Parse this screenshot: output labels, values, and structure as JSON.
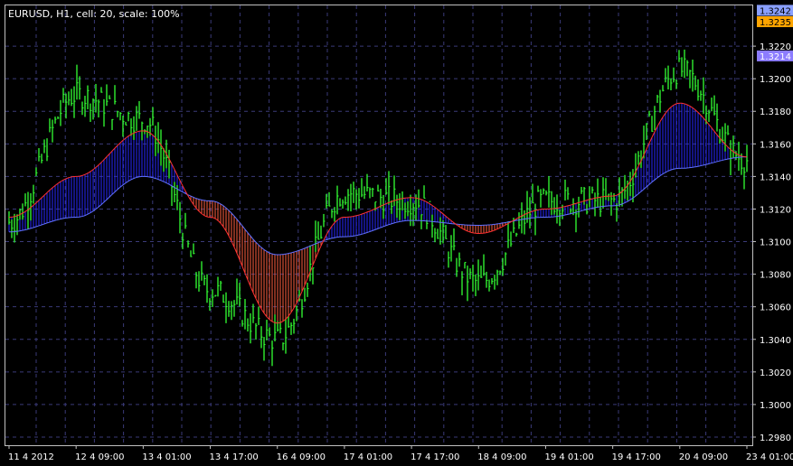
{
  "header": {
    "title": "EURUSD, H1, cell: 20, scale: 100%"
  },
  "price_tags": [
    {
      "label": "1.3242",
      "value": 1.3242,
      "bg": "#8aa0ff",
      "fg": "#000000"
    },
    {
      "label": "1.3235",
      "value": 1.3235,
      "bg": "#ffa500",
      "fg": "#000000"
    },
    {
      "label": "1.3214",
      "value": 1.3214,
      "bg": "#8c7cff",
      "fg": "#ffffff"
    }
  ],
  "colors": {
    "background": "#000000",
    "frame": "#c0c0c0",
    "grid": "#3a3a78",
    "bars": "#33ff33",
    "fast_line": "#ff3030",
    "slow_line": "#6070ff",
    "fill_up": "#2828ff",
    "fill_down": "#ff6040"
  },
  "chart_data": {
    "type": "line",
    "title": "EURUSD, H1, cell: 20, scale: 100%",
    "ylim": [
      1.2975,
      1.3245
    ],
    "grid": true,
    "y_ticks": [
      "1.3220",
      "1.3200",
      "1.3180",
      "1.3160",
      "1.3140",
      "1.3120",
      "1.3100",
      "1.3080",
      "1.3060",
      "1.3040",
      "1.3020",
      "1.3000",
      "1.2980"
    ],
    "x_ticks": [
      "11 4 2012",
      "12 4 09:00",
      "13 4 01:00",
      "13 4 17:00",
      "16 4 09:00",
      "17 4 01:00",
      "17 4 17:00",
      "18 4 09:00",
      "19 4 01:00",
      "19 4 17:00",
      "20 4 09:00",
      "23 4 01:00"
    ],
    "x": [
      "11 4 2012",
      "12 4 09:00",
      "13 4 01:00",
      "13 4 17:00",
      "16 4 09:00",
      "17 4 01:00",
      "17 4 17:00",
      "18 4 09:00",
      "19 4 01:00",
      "19 4 17:00",
      "20 4 09:00",
      "23 4 01:00"
    ],
    "series": [
      {
        "name": "price",
        "values": [
          1.3112,
          1.319,
          1.3175,
          1.307,
          1.304,
          1.313,
          1.3125,
          1.3075,
          1.3125,
          1.3125,
          1.3205,
          1.315
        ]
      },
      {
        "name": "fast",
        "values": [
          1.3115,
          1.314,
          1.3168,
          1.3115,
          1.305,
          1.3115,
          1.3127,
          1.3105,
          1.312,
          1.3128,
          1.3185,
          1.3152
        ]
      },
      {
        "name": "slow",
        "values": [
          1.3106,
          1.3115,
          1.314,
          1.3125,
          1.3092,
          1.3103,
          1.3113,
          1.311,
          1.3115,
          1.3122,
          1.3145,
          1.3152
        ]
      }
    ]
  }
}
